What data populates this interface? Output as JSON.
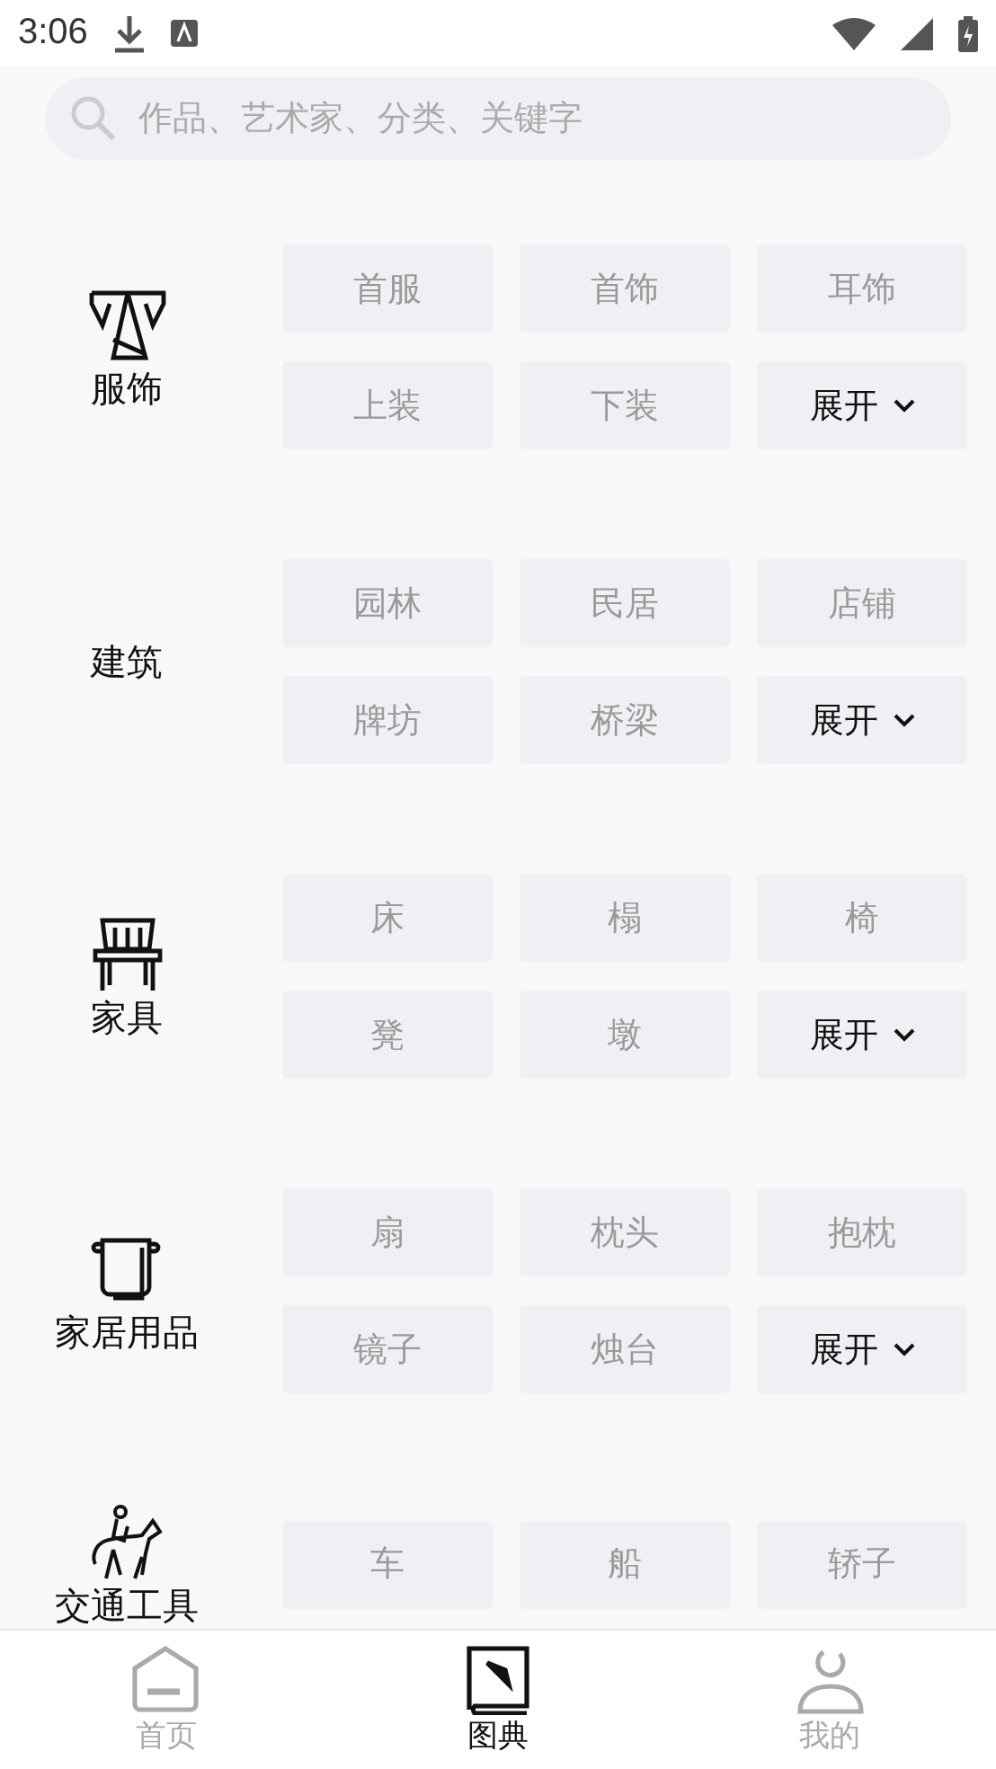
{
  "status_bar": {
    "time": "3:06"
  },
  "search": {
    "placeholder": "作品、艺术家、分类、关键字"
  },
  "categories": [
    {
      "name": "服饰",
      "chips": [
        {
          "kind": "tag",
          "label": "首服"
        },
        {
          "kind": "tag",
          "label": "首饰"
        },
        {
          "kind": "tag",
          "label": "耳饰"
        },
        {
          "kind": "tag",
          "label": "上装"
        },
        {
          "kind": "tag",
          "label": "下装"
        },
        {
          "kind": "expand",
          "label": "展开"
        }
      ]
    },
    {
      "name": "建筑",
      "chips": [
        {
          "kind": "tag",
          "label": "园林"
        },
        {
          "kind": "tag",
          "label": "民居"
        },
        {
          "kind": "tag",
          "label": "店铺"
        },
        {
          "kind": "tag",
          "label": "牌坊"
        },
        {
          "kind": "tag",
          "label": "桥梁"
        },
        {
          "kind": "expand",
          "label": "展开"
        }
      ]
    },
    {
      "name": "家具",
      "chips": [
        {
          "kind": "tag",
          "label": "床"
        },
        {
          "kind": "tag",
          "label": "榻"
        },
        {
          "kind": "tag",
          "label": "椅"
        },
        {
          "kind": "tag",
          "label": "凳"
        },
        {
          "kind": "tag",
          "label": "墩"
        },
        {
          "kind": "expand",
          "label": "展开"
        }
      ]
    },
    {
      "name": "家居用品",
      "chips": [
        {
          "kind": "tag",
          "label": "扇"
        },
        {
          "kind": "tag",
          "label": "枕头"
        },
        {
          "kind": "tag",
          "label": "抱枕"
        },
        {
          "kind": "tag",
          "label": "镜子"
        },
        {
          "kind": "tag",
          "label": "烛台"
        },
        {
          "kind": "expand",
          "label": "展开"
        }
      ]
    },
    {
      "name": "交通工具",
      "chips": [
        {
          "kind": "tag",
          "label": "车"
        },
        {
          "kind": "tag",
          "label": "船"
        },
        {
          "kind": "tag",
          "label": "轿子"
        }
      ]
    }
  ],
  "nav": [
    {
      "label": "首页",
      "selected": false
    },
    {
      "label": "图典",
      "selected": true
    },
    {
      "label": "我的",
      "selected": false
    }
  ]
}
